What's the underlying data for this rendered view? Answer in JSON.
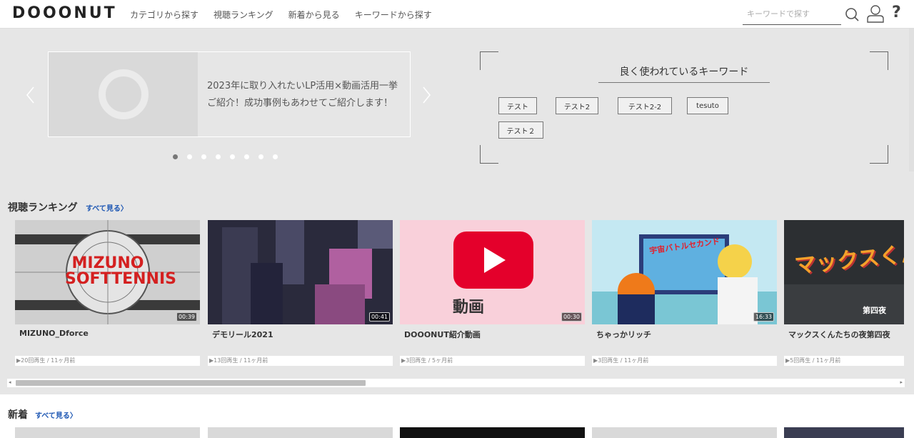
{
  "header": {
    "logo": "DOOONUT",
    "nav": [
      "カテゴリから探す",
      "視聴ランキング",
      "新着から見る",
      "キーワードから探す"
    ],
    "search_placeholder": "キーワードで探す",
    "help": "?"
  },
  "banner": {
    "text": "2023年に取り入れたいLP活用×動画活用一挙ご紹介！成功事例もあわせてご紹介します！",
    "slide_count": 8,
    "active_slide": 1
  },
  "keywords": {
    "title": "良く使われているキーワード",
    "tags": [
      "テスト",
      "テスト2",
      "テスト2-2",
      "tesuto",
      "テスト２"
    ]
  },
  "ranking": {
    "title": "視聴ランキング",
    "see_all": "すべて見る〉",
    "cards": [
      {
        "title": "MIZUNO_Dforce",
        "duration": "00:39",
        "meta": "▶20回再生 / 11ヶ月前",
        "thumb_text": "MIZUNO SOFTTENNIS"
      },
      {
        "title": "デモリール2021",
        "duration": "00:41",
        "meta": "▶13回再生 / 11ヶ月前"
      },
      {
        "title": "DOOONUT紹介動画",
        "duration": "00:30",
        "meta": "▶3回再生 / 5ヶ月前",
        "thumb_text": "動画"
      },
      {
        "title": "ちゃっかリッチ",
        "duration": "16:33",
        "meta": "▶3回再生 / 11ヶ月前",
        "thumb_text": "宇宙バトルセカンド"
      },
      {
        "title": "マックスくんたちの夜第四夜",
        "duration": "",
        "meta": "▶5回再生 / 11ヶ月前",
        "thumb_text": "マックスくん",
        "thumb_sub": "第四夜"
      }
    ]
  },
  "new": {
    "title": "新着",
    "see_all": "すべて見る〉"
  },
  "colors": {
    "accent_link": "#1c56b3",
    "youtube_red": "#e4002b",
    "background": "#e6e6e6"
  }
}
